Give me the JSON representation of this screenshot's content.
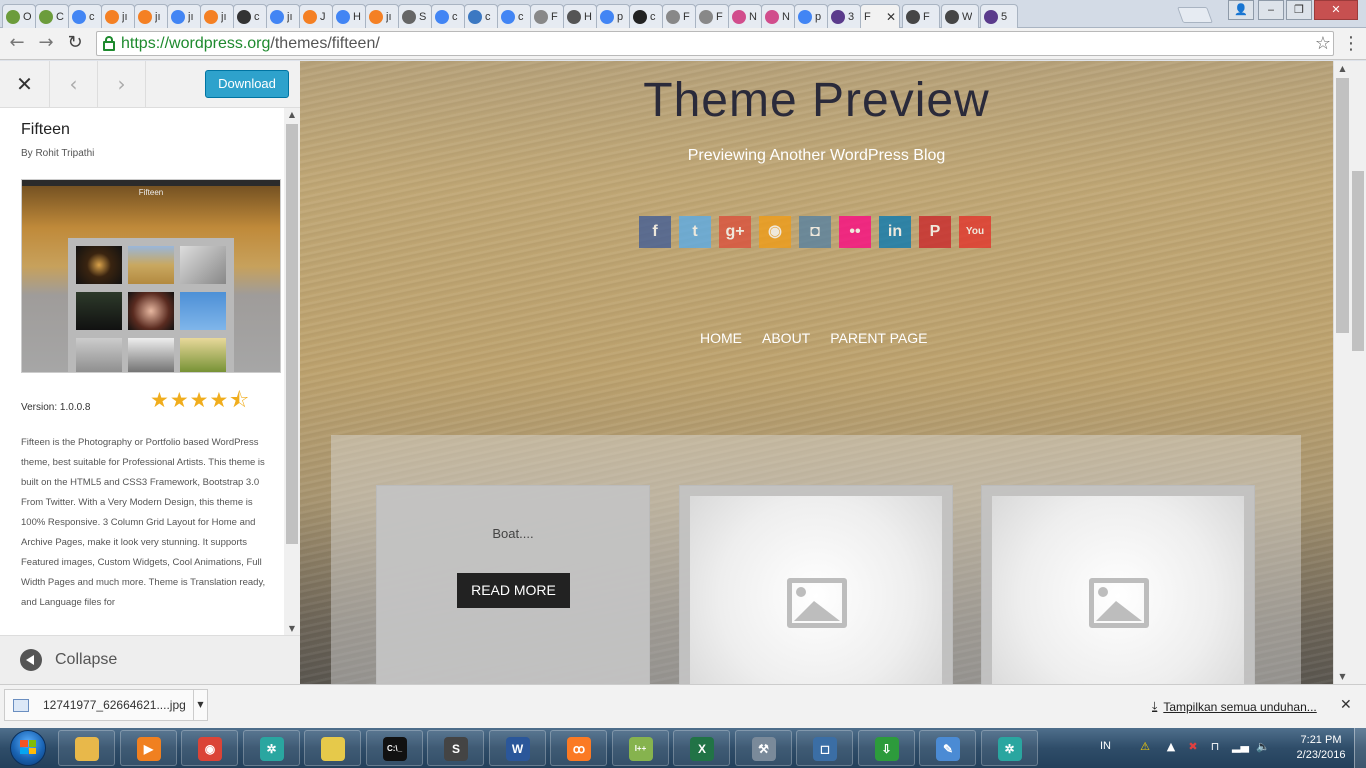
{
  "browser": {
    "tabs": [
      {
        "label": "O",
        "color": "#6c9c3c"
      },
      {
        "label": "C",
        "color": "#6c9c3c"
      },
      {
        "label": "c",
        "color": "#4285f4"
      },
      {
        "label": "jı",
        "color": "#f48024"
      },
      {
        "label": "jı",
        "color": "#f48024"
      },
      {
        "label": "jı",
        "color": "#4285f4"
      },
      {
        "label": "jı",
        "color": "#f48024"
      },
      {
        "label": "c",
        "color": "#333333"
      },
      {
        "label": "jı",
        "color": "#4285f4"
      },
      {
        "label": "J",
        "color": "#f48024"
      },
      {
        "label": "H",
        "color": "#4285f4"
      },
      {
        "label": "jı",
        "color": "#f48024"
      },
      {
        "label": "S",
        "color": "#666666"
      },
      {
        "label": "c",
        "color": "#4285f4"
      },
      {
        "label": "c",
        "color": "#3b78c2"
      },
      {
        "label": "c",
        "color": "#4285f4"
      },
      {
        "label": "F",
        "color": "#888888"
      },
      {
        "label": "H",
        "color": "#555555"
      },
      {
        "label": "p",
        "color": "#4285f4"
      },
      {
        "label": "c",
        "color": "#222222"
      },
      {
        "label": "F",
        "color": "#888888"
      },
      {
        "label": "F",
        "color": "#888888"
      },
      {
        "label": "N",
        "color": "#d14d8c"
      },
      {
        "label": "N",
        "color": "#d14d8c"
      },
      {
        "label": "p",
        "color": "#4285f4"
      },
      {
        "label": "3",
        "color": "#5b3b8c"
      }
    ],
    "active_tab": {
      "label": "F",
      "color": "#464646"
    },
    "tail_tabs": [
      {
        "label": "F",
        "color": "#464646"
      },
      {
        "label": "W",
        "color": "#464646"
      },
      {
        "label": "5",
        "color": "#5b3b8c"
      }
    ],
    "url_scheme": "https://",
    "url_host": "wordpress.org",
    "url_path": "/themes/fifteen/"
  },
  "sidebar": {
    "close_label": "✕",
    "prev_label": "‹",
    "next_label": "›",
    "download_label": "Download",
    "theme_name": "Fifteen",
    "author": "By Rohit Tripathi",
    "version": "Version: 1.0.0.8",
    "rating": 4.5,
    "rating_stars": "★★★★⯪",
    "description": "Fifteen is the Photography or Portfolio based WordPress theme, best suitable for Professional Artists. This theme is built on the HTML5 and CSS3 Framework, Bootstrap 3.0 From Twitter. With a Very Modern Design, this theme is 100% Responsive. 3 Column Grid Layout for Home and Archive Pages, make it look very stunning. It supports Featured images, Custom Widgets, Cool Animations, Full Width Pages and much more. Theme is Translation ready, and Language files for",
    "collapse_label": "Collapse",
    "screenshot_title": "Fifteen"
  },
  "preview": {
    "site_title": "Theme Preview",
    "tagline": "Previewing Another WordPress Blog",
    "social": [
      {
        "name": "facebook-icon",
        "glyph": "f",
        "color": "#3b5998"
      },
      {
        "name": "twitter-icon",
        "glyph": "t",
        "color": "#55acee"
      },
      {
        "name": "google-plus-icon",
        "glyph": "g+",
        "color": "#dd4b39"
      },
      {
        "name": "rss-icon",
        "glyph": "◉",
        "color": "#f39c12"
      },
      {
        "name": "instagram-icon",
        "glyph": "◘",
        "color": "#517fa4"
      },
      {
        "name": "flickr-icon",
        "glyph": "••",
        "color": "#ff0084"
      },
      {
        "name": "linkedin-icon",
        "glyph": "in",
        "color": "#0077b5"
      },
      {
        "name": "pinterest-icon",
        "glyph": "P",
        "color": "#cb2027"
      },
      {
        "name": "youtube-icon",
        "glyph": "You",
        "color": "#e52d27"
      }
    ],
    "nav": [
      "HOME",
      "ABOUT",
      "PARENT PAGE"
    ],
    "post_excerpt": "Boat....",
    "read_more": "READ MORE"
  },
  "downloads": {
    "file_name": "12741977_62664621....jpg",
    "show_all": "Tampilkan semua unduhan..."
  },
  "taskbar": {
    "apps": [
      {
        "name": "explorer",
        "color": "#e8b84a",
        "glyph": ""
      },
      {
        "name": "media-player",
        "color": "#f08020",
        "glyph": "▶"
      },
      {
        "name": "chrome",
        "color": "#db4437",
        "glyph": "◉"
      },
      {
        "name": "app-green",
        "color": "#2aa6a0",
        "glyph": "✲"
      },
      {
        "name": "sticky-notes",
        "color": "#e6c94a",
        "glyph": ""
      },
      {
        "name": "cmd",
        "color": "#111111",
        "glyph": "C:\\_"
      },
      {
        "name": "sublime",
        "color": "#444444",
        "glyph": "S"
      },
      {
        "name": "word",
        "color": "#2b579a",
        "glyph": "W"
      },
      {
        "name": "xampp",
        "color": "#fb7a24",
        "glyph": "ꝏ"
      },
      {
        "name": "notepadpp",
        "color": "#86b34e",
        "glyph": "I++"
      },
      {
        "name": "excel",
        "color": "#217346",
        "glyph": "X"
      },
      {
        "name": "network-tool",
        "color": "#7a8a9a",
        "glyph": "⚒"
      },
      {
        "name": "virtualbox",
        "color": "#3b6ea5",
        "glyph": "◻"
      },
      {
        "name": "download-manager",
        "color": "#2d9b3c",
        "glyph": "⇩"
      },
      {
        "name": "paint",
        "color": "#4b8bd4",
        "glyph": "✎"
      },
      {
        "name": "app-green-2",
        "color": "#2aa6a0",
        "glyph": "✲"
      }
    ],
    "language": "IN",
    "time": "7:21 PM",
    "date": "2/23/2016"
  }
}
